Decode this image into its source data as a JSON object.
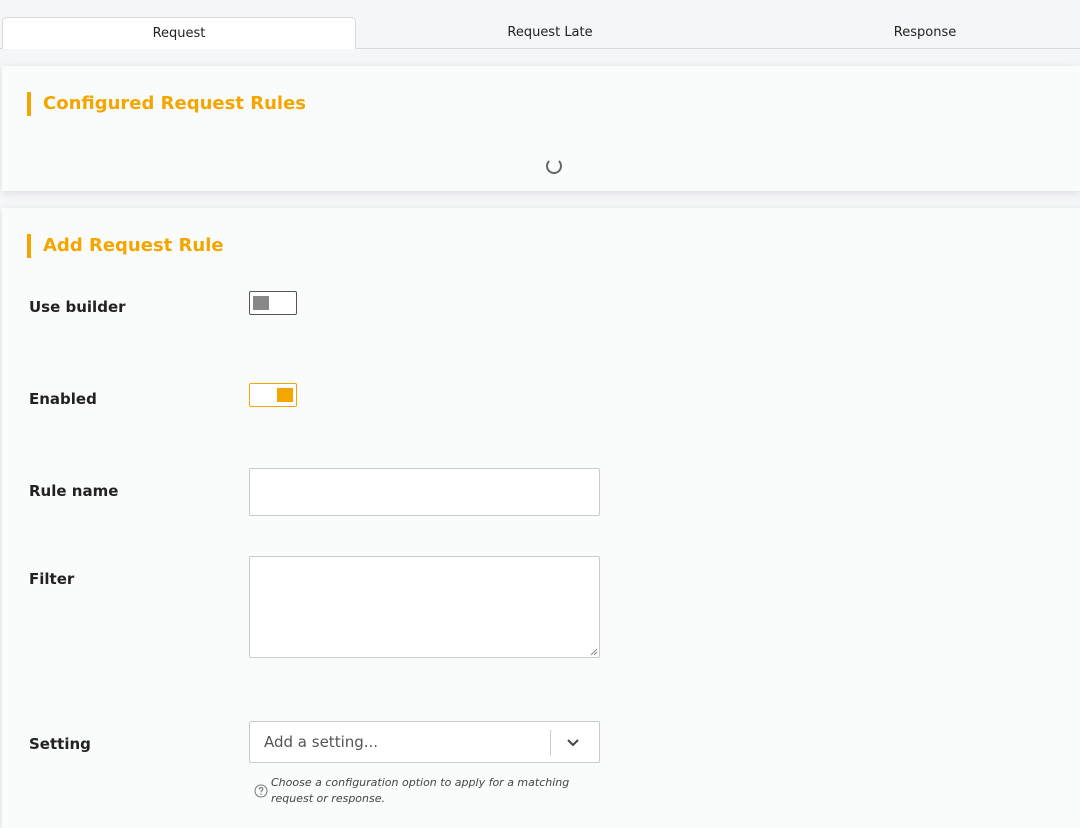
{
  "tabs": [
    {
      "label": "Request",
      "active": true
    },
    {
      "label": "Request Late",
      "active": false
    },
    {
      "label": "Response",
      "active": false
    }
  ],
  "configured": {
    "title": "Configured Request Rules",
    "loading_icon": "spinner-icon"
  },
  "add_rule": {
    "title": "Add Request Rule",
    "use_builder": {
      "label": "Use builder",
      "state": "off"
    },
    "enabled": {
      "label": "Enabled",
      "state": "on"
    },
    "rule_name": {
      "label": "Rule name",
      "value": ""
    },
    "filter": {
      "label": "Filter",
      "value": ""
    },
    "setting": {
      "label": "Setting",
      "placeholder": "Add a setting...",
      "help": "Choose a configuration option to apply for a matching request or response.",
      "help_icon": "question-circle-icon",
      "arrow_icon": "chevron-down-icon"
    }
  },
  "colors": {
    "accent": "#f5a500",
    "background": "#f5f6f7",
    "panel": "#fafbfb"
  }
}
